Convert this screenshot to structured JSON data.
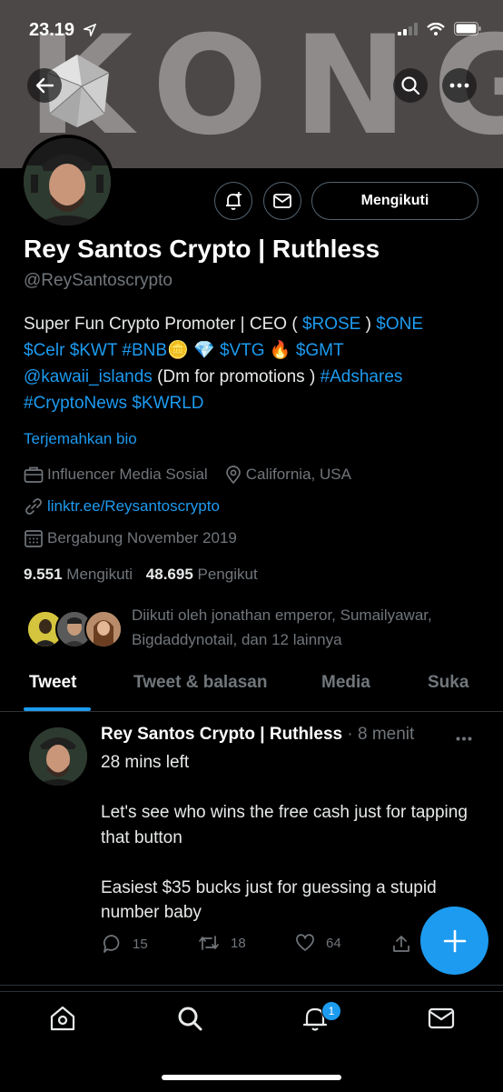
{
  "status_bar": {
    "time": "23.19"
  },
  "banner": {
    "text": "KONG"
  },
  "profile": {
    "name": "Rey Santos Crypto | Ruthless",
    "handle": "@ReySantoscrypto",
    "follow_button": "Mengikuti",
    "bio": {
      "line1_a": "Super Fun Crypto Promoter | CEO ( ",
      "line1_rose": "$ROSE",
      "line1_b": " ) ",
      "line1_one": "$ONE",
      "line2_celr": "$Celr",
      "line2_kwt": "$KWT",
      "line2_bnb": "#BNB",
      "line2_coin": "🪙",
      "line2_diamond": "💎",
      "line2_vtg": "$VTG",
      "line2_fire": "🔥",
      "line2_gmt": "$GMT",
      "line3_kawaii": "@kawaii_islands",
      "line3_b": " (Dm for promotions ) ",
      "line3_adshares": "#Adshares",
      "line4_cryptonews": "#CryptoNews",
      "line4_kwrld": "$KWRLD"
    },
    "translate_bio": "Terjemahkan bio",
    "category": "Influencer Media Sosial",
    "location": "California, USA",
    "link": "linktr.ee/Reysantoscrypto",
    "joined": "Bergabung November 2019",
    "following_count": "9.551",
    "following_label": "Mengikuti",
    "followers_count": "48.695",
    "followers_label": "Pengikut",
    "followed_by": "Diikuti oleh jonathan emperor, Sumailyawar, Bigdaddynotail, dan 12 lainnya"
  },
  "tabs": [
    "Tweet",
    "Tweet & balasan",
    "Media",
    "Suka"
  ],
  "tweet": {
    "author": "Rey Santos Crypto | Ruthless",
    "time": "· 8 menit",
    "text": "28 mins left\n\nLet's see who wins the free cash just for tapping that button\n\nEasiest $35 bucks just for guessing a stupid number baby",
    "replies": "15",
    "retweets": "18",
    "likes": "64"
  },
  "nav": {
    "notifications_badge": "1"
  },
  "colors": {
    "accent": "#1d9bf0",
    "muted": "#71767b",
    "background": "#000000"
  },
  "icons": [
    "back-arrow-icon",
    "search-icon",
    "more-icon",
    "bell-plus-icon",
    "mail-icon",
    "briefcase-icon",
    "location-icon",
    "link-icon",
    "calendar-icon",
    "reply-icon",
    "retweet-icon",
    "like-icon",
    "share-icon",
    "compose-plus-icon",
    "home-icon",
    "search-icon",
    "bell-icon",
    "mail-icon"
  ]
}
